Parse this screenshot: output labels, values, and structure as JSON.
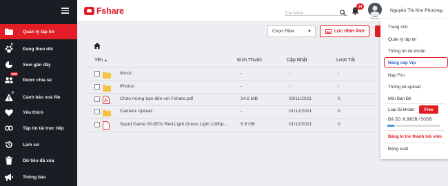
{
  "app": {
    "name": "Fshare"
  },
  "header": {
    "search_placeholder": "Tìm kiếm...",
    "notification_count": "14",
    "username": "Nguyễn Thị Kim Phượng",
    "avatar_tag": "Member"
  },
  "sidebar": {
    "items": [
      {
        "label": "Quản lý tập tin",
        "icon": "folder-icon",
        "active": true
      },
      {
        "label": "Đang theo dõi",
        "icon": "paw-icon",
        "badge": "0"
      },
      {
        "label": "Xem gần đây",
        "icon": "pie-chart-icon"
      },
      {
        "label": "Được chia sẻ",
        "icon": "users-icon",
        "badge": "MỚI"
      },
      {
        "label": "Cảnh báo xoá file",
        "icon": "warning-icon",
        "badge": "0"
      },
      {
        "label": "Yêu thích",
        "icon": "heart-icon"
      },
      {
        "label": "Tập tin tải trực tiếp",
        "icon": "link-icon"
      },
      {
        "label": "Lịch sử",
        "icon": "history-icon"
      },
      {
        "label": "Dữ liệu đã xóa",
        "icon": "trash-icon"
      },
      {
        "label": "Thông báo",
        "icon": "megaphone-icon"
      }
    ]
  },
  "toolbar": {
    "filter_label": "Chọn Filter",
    "upload_label": "LỌC HÌNH ẢNH"
  },
  "table": {
    "columns": [
      "Tên",
      "Kích Thước",
      "Cập Nhật",
      "Lượt Tải"
    ],
    "rows": [
      {
        "type": "folder",
        "name": "Music",
        "size": "-",
        "date": "-",
        "downloads": "-"
      },
      {
        "type": "folder",
        "name": "Photos",
        "size": "-",
        "date": "-",
        "downloads": "-"
      },
      {
        "type": "pdf",
        "name": "Chào mừng bạn đến với Fshare.pdf",
        "size": "14.6 MB",
        "date": "03/11/2021",
        "downloads": "0"
      },
      {
        "type": "folder",
        "name": "Camera Upload",
        "size": "-",
        "date": "01/12/2021",
        "downloads": "0"
      },
      {
        "type": "file",
        "name": "Squid.Game.S01E01.Red.Light.Green.Light.1080p....",
        "size": "5.9 GB",
        "date": "01/12/2021",
        "downloads": "0"
      }
    ]
  },
  "user_menu": {
    "items": [
      "Trang chủ",
      "Quản lý tập tin",
      "Thông tin tài khoản",
      "Nâng cấp Vip",
      "Nạp Fxu",
      "Thống kê upload",
      "Mời Bạn Bè"
    ],
    "account_type_label": "Loại tài khoản",
    "account_type_value": "Free",
    "quota_text": "Đã SD: 6.89GB / 50GB",
    "quota_fraction": 0.138,
    "register_label": "Đăng kí trở thành hội viên",
    "logout_label": "Đăng xuất"
  },
  "colors": {
    "brand": "#e21d25",
    "sidebar_bg": "#1b1d24",
    "vip_text": "#2f62c8"
  }
}
